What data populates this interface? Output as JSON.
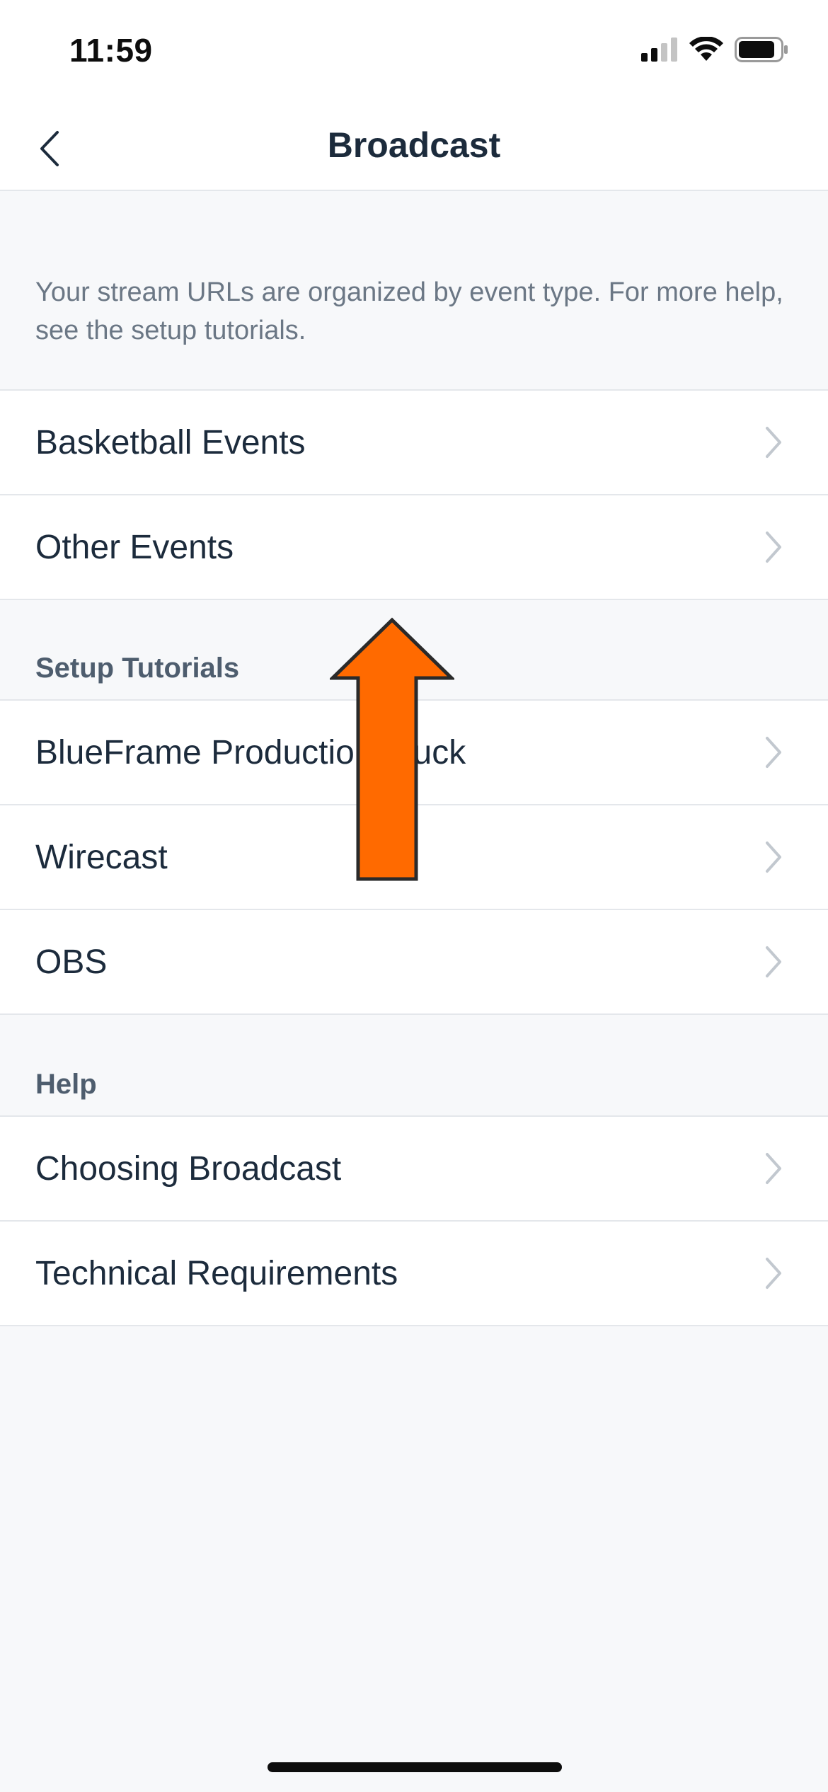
{
  "status_bar": {
    "time": "11:59"
  },
  "nav": {
    "title": "Broadcast"
  },
  "intro": {
    "text": "Your stream URLs are organized by event type. For more help, see the setup tutorials."
  },
  "stream_urls": {
    "items": [
      {
        "label": "Basketball Events"
      },
      {
        "label": "Other Events"
      }
    ]
  },
  "setup_tutorials": {
    "header": "Setup Tutorials",
    "items": [
      {
        "label": "BlueFrame Production Truck"
      },
      {
        "label": "Wirecast"
      },
      {
        "label": "OBS"
      }
    ]
  },
  "help": {
    "header": "Help",
    "items": [
      {
        "label": "Choosing Broadcast"
      },
      {
        "label": "Technical Requirements"
      }
    ]
  },
  "colors": {
    "accent_arrow": "#ff6a00",
    "text_primary": "#1c2b3c",
    "text_secondary": "#6b7785",
    "background": "#f7f8fa"
  },
  "icons": [
    "back-chevron-icon",
    "chevron-right-icon",
    "signal-icon",
    "wifi-icon",
    "battery-icon",
    "up-arrow-icon"
  ]
}
